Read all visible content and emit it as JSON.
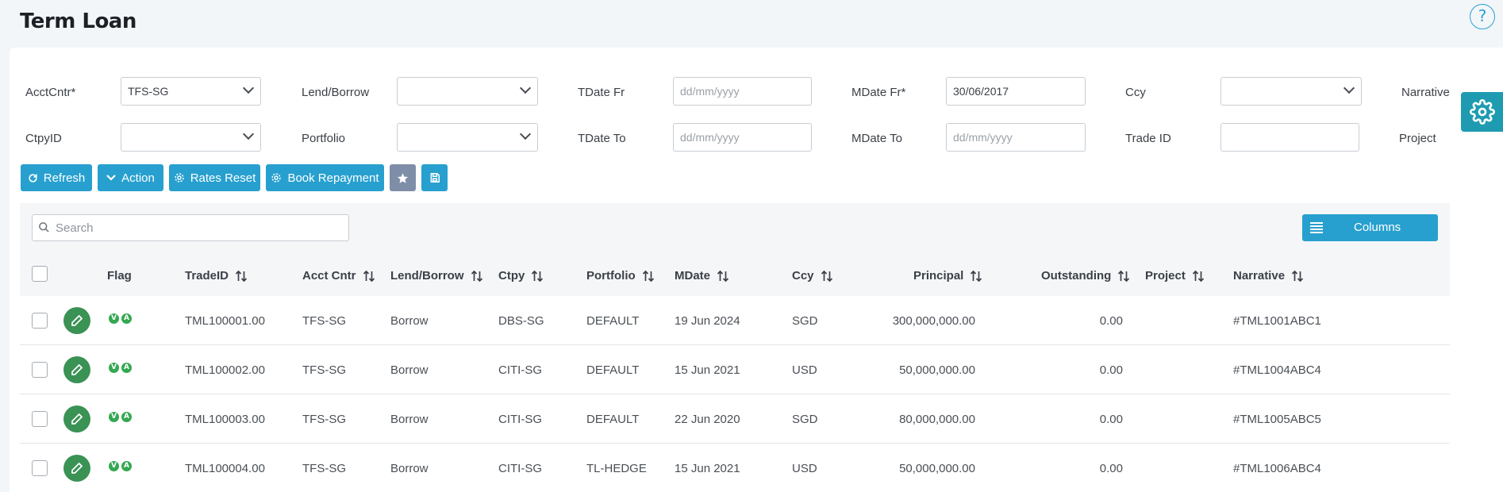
{
  "page": {
    "title": "Term Loan",
    "help_glyph": "?"
  },
  "filters": {
    "acct_cntr": {
      "label": "AcctCntr*",
      "value": "TFS-SG"
    },
    "lend_borrow": {
      "label": "Lend/Borrow",
      "value": ""
    },
    "tdate_fr": {
      "label": "TDate Fr",
      "placeholder": "dd/mm/yyyy"
    },
    "mdate_fr": {
      "label": "MDate Fr*",
      "value": "30/06/2017"
    },
    "ccy": {
      "label": "Ccy",
      "value": ""
    },
    "narrative": {
      "label": "Narrative"
    },
    "ctpy_id": {
      "label": "CtpyID",
      "value": ""
    },
    "portfolio": {
      "label": "Portfolio",
      "value": ""
    },
    "tdate_to": {
      "label": "TDate To",
      "placeholder": "dd/mm/yyyy"
    },
    "mdate_to": {
      "label": "MDate To",
      "placeholder": "dd/mm/yyyy"
    },
    "trade_id": {
      "label": "Trade ID",
      "value": ""
    },
    "project": {
      "label": "Project"
    }
  },
  "toolbar": {
    "refresh": "Refresh",
    "action": "Action",
    "rates_reset": "Rates Reset",
    "book_repayment": "Book Repayment"
  },
  "grid": {
    "search_placeholder": "Search",
    "columns_button": "Columns",
    "headers": {
      "flag": "Flag",
      "trade_id": "TradeID",
      "acct_cntr": "Acct Cntr",
      "lend_borrow": "Lend/Borrow",
      "ctpy": "Ctpy",
      "portfolio": "Portfolio",
      "mdate": "MDate",
      "ccy": "Ccy",
      "principal": "Principal",
      "outstanding": "Outstanding",
      "project": "Project",
      "narrative": "Narrative"
    },
    "flag_badges": [
      "V",
      "A"
    ],
    "rows": [
      {
        "trade_id": "TML100001.00",
        "acct_cntr": "TFS-SG",
        "lend_borrow": "Borrow",
        "ctpy": "DBS-SG",
        "portfolio": "DEFAULT",
        "mdate": "19 Jun 2024",
        "ccy": "SGD",
        "principal": "300,000,000.00",
        "outstanding": "0.00",
        "project": "",
        "narrative": "#TML1001ABC1"
      },
      {
        "trade_id": "TML100002.00",
        "acct_cntr": "TFS-SG",
        "lend_borrow": "Borrow",
        "ctpy": "CITI-SG",
        "portfolio": "DEFAULT",
        "mdate": "15 Jun 2021",
        "ccy": "USD",
        "principal": "50,000,000.00",
        "outstanding": "0.00",
        "project": "",
        "narrative": "#TML1004ABC4"
      },
      {
        "trade_id": "TML100003.00",
        "acct_cntr": "TFS-SG",
        "lend_borrow": "Borrow",
        "ctpy": "CITI-SG",
        "portfolio": "DEFAULT",
        "mdate": "22 Jun 2020",
        "ccy": "SGD",
        "principal": "80,000,000.00",
        "outstanding": "0.00",
        "project": "",
        "narrative": "#TML1005ABC5"
      },
      {
        "trade_id": "TML100004.00",
        "acct_cntr": "TFS-SG",
        "lend_borrow": "Borrow",
        "ctpy": "CITI-SG",
        "portfolio": "TL-HEDGE",
        "mdate": "15 Jun 2021",
        "ccy": "USD",
        "principal": "50,000,000.00",
        "outstanding": "0.00",
        "project": "",
        "narrative": "#TML1006ABC4"
      }
    ]
  },
  "colors": {
    "accent": "#27a0cf",
    "edit_green": "#3a9254",
    "badge_green": "#35a852",
    "gear_tab": "#1e9bb0",
    "star_button": "#7f8ea8"
  }
}
